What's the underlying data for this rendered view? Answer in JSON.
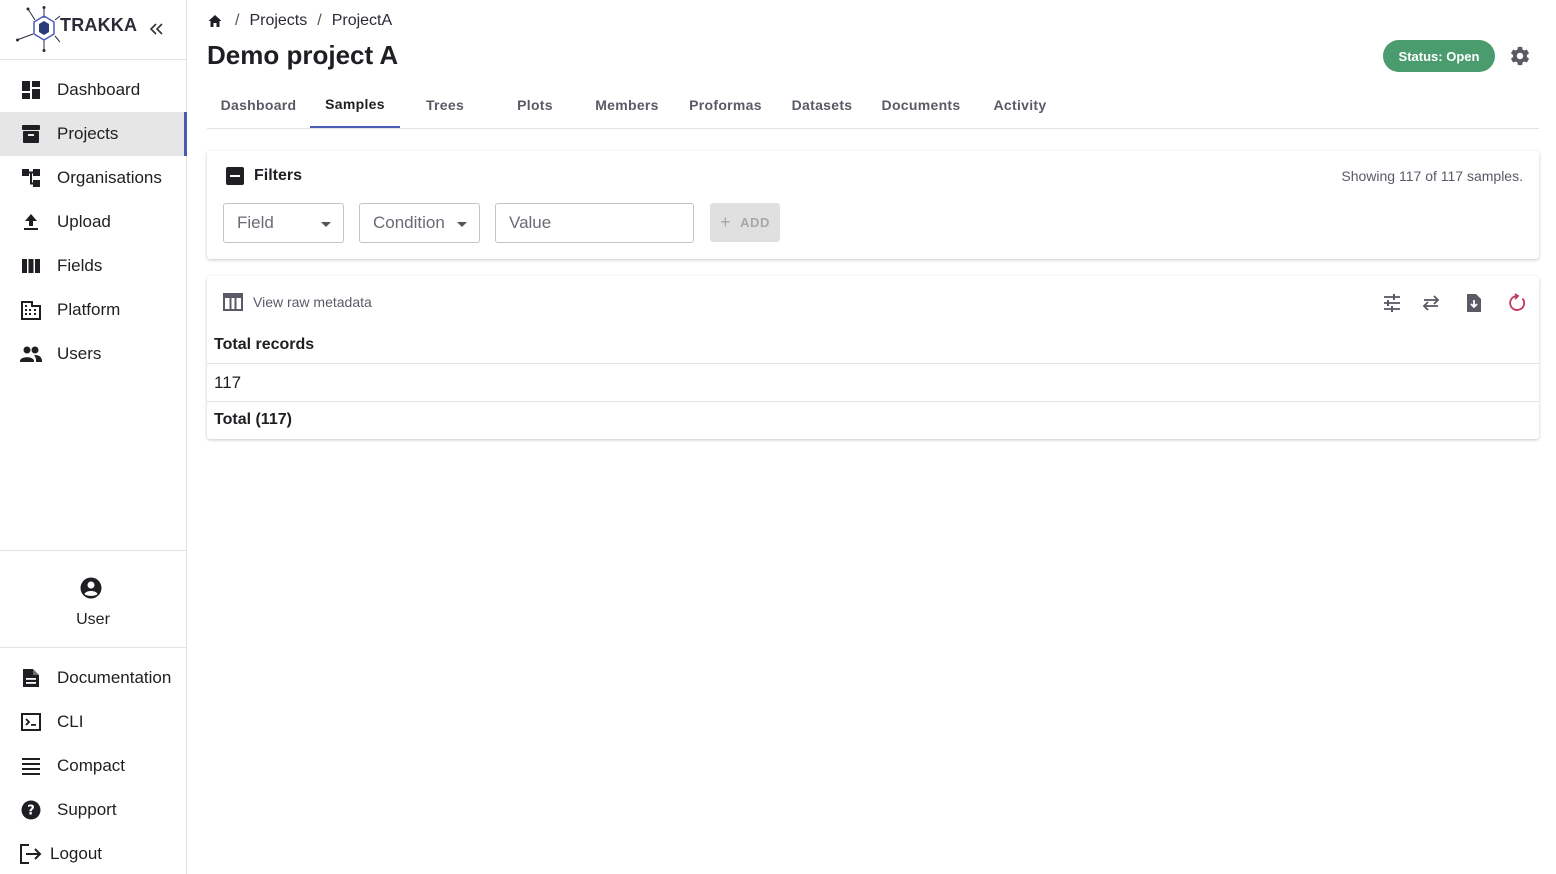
{
  "app": {
    "logo_text": "TRAKKA",
    "accent_color": "#4b5bb5",
    "status_color": "#4a9b6e"
  },
  "sidebar": {
    "collapse_icon": "double-chevron-left-icon",
    "items": [
      {
        "label": "Dashboard",
        "icon": "dashboard-icon"
      },
      {
        "label": "Projects",
        "icon": "archive-box-icon",
        "active": true
      },
      {
        "label": "Organisations",
        "icon": "org-tree-icon"
      },
      {
        "label": "Upload",
        "icon": "upload-icon"
      },
      {
        "label": "Fields",
        "icon": "columns-icon"
      },
      {
        "label": "Platform",
        "icon": "building-icon"
      },
      {
        "label": "Users",
        "icon": "people-icon"
      }
    ],
    "user_label": "User",
    "bottom_items": [
      {
        "label": "Documentation",
        "icon": "document-icon"
      },
      {
        "label": "CLI",
        "icon": "terminal-icon"
      },
      {
        "label": "Compact",
        "icon": "menu-lines-icon"
      },
      {
        "label": "Support",
        "icon": "help-circle-icon"
      },
      {
        "label": "Logout",
        "icon": "logout-icon"
      }
    ]
  },
  "breadcrumb": {
    "sep": "/",
    "items": [
      "Projects",
      "ProjectA"
    ]
  },
  "header": {
    "title": "Demo project A",
    "status": "Status: Open"
  },
  "tabs": [
    {
      "label": "Dashboard"
    },
    {
      "label": "Samples",
      "active": true
    },
    {
      "label": "Trees"
    },
    {
      "label": "Plots"
    },
    {
      "label": "Members"
    },
    {
      "label": "Proformas"
    },
    {
      "label": "Datasets"
    },
    {
      "label": "Documents"
    },
    {
      "label": "Activity"
    }
  ],
  "filters": {
    "title": "Filters",
    "showing": "Showing 117 of 117 samples.",
    "field_placeholder": "Field",
    "condition_placeholder": "Condition",
    "value_placeholder": "Value",
    "add_label": "ADD"
  },
  "table": {
    "view_raw_label": "View raw metadata",
    "column_header": "Total records",
    "rows": [
      "117"
    ],
    "footer": "Total (117)"
  }
}
